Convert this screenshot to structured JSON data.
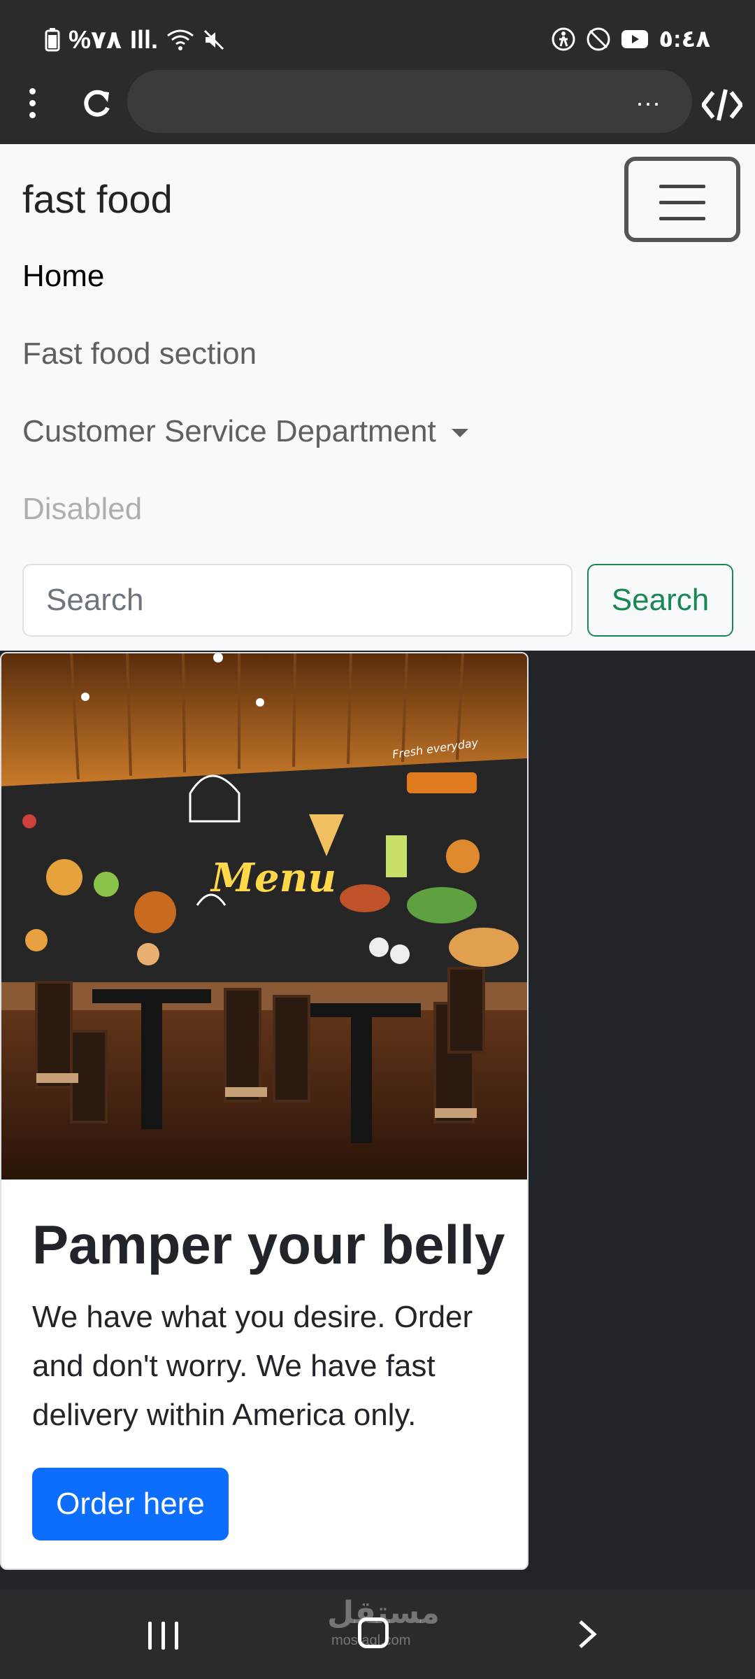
{
  "status_bar": {
    "battery": "%٧٨",
    "signal": "Ill.",
    "time": "٥:٤٨"
  },
  "browser": {
    "url_more": "...",
    "icons": [
      "menu-dots-icon",
      "reload-icon",
      "code-icon"
    ]
  },
  "navbar": {
    "brand": "fast food",
    "links": [
      {
        "label": "Home"
      },
      {
        "label": "Fast food section"
      },
      {
        "label": "Customer Service Department"
      },
      {
        "label": "Disabled"
      }
    ],
    "search_placeholder": "Search",
    "search_button": "Search"
  },
  "card": {
    "image_menu_text": "Menu",
    "image_tagline": "Fresh everyday",
    "title": "Pamper your belly",
    "text": "We have what you desire. Order and don't worry. We have fast delivery within America only.",
    "button": "Order here"
  },
  "watermark": {
    "arabic": "مستقل",
    "latin": "mostaql.com"
  },
  "colors": {
    "primary": "#0d6efd",
    "success": "#198754",
    "dark": "#212529",
    "light": "#f8f9fa"
  }
}
